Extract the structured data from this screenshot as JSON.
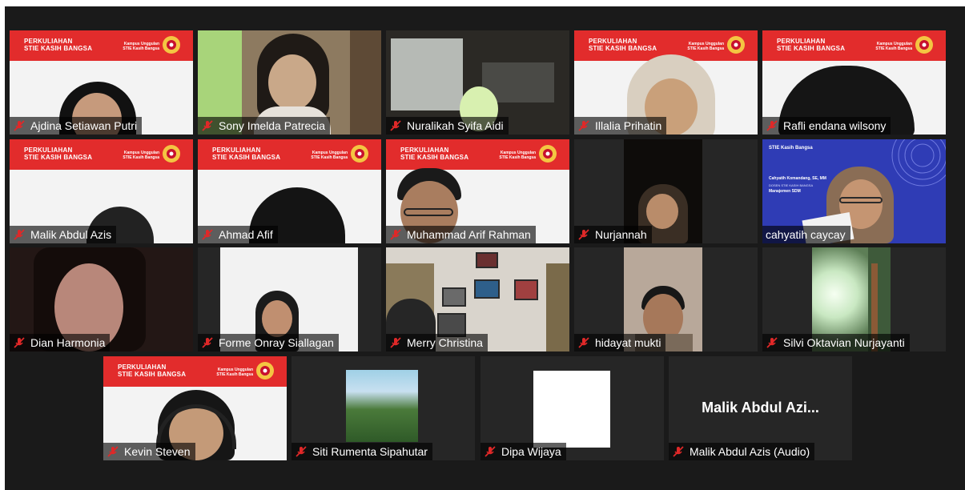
{
  "banner": {
    "line1": "PERKULIAHAN",
    "line2": "STIE KASIH BANGSA",
    "sub1": "Kampus Unggulan",
    "sub2": "STIE Kasih Bangsa"
  },
  "slide": {
    "header": "STIE Kasih Bangsa",
    "presenter": "Cahyatih Komandang, SE, MM",
    "role1": "DOSEN STIE KASIH BANGSA",
    "course": "Manajemen SDM"
  },
  "participants": [
    {
      "name": "Ajdina Setiawan Putri",
      "muted": true
    },
    {
      "name": "Sony Imelda Patrecia",
      "muted": true
    },
    {
      "name": "Nuralikah Syifa Aidi",
      "muted": true
    },
    {
      "name": "Illalia Prihatin",
      "muted": true
    },
    {
      "name": "Rafli endana wilsony",
      "muted": true
    },
    {
      "name": "Malik Abdul Azis",
      "muted": true
    },
    {
      "name": "Ahmad Afif",
      "muted": true
    },
    {
      "name": "Muhammad Arif Rahman",
      "muted": true
    },
    {
      "name": "Nurjannah",
      "muted": true
    },
    {
      "name": "cahyatih caycay",
      "muted": false,
      "active_speaker": true
    },
    {
      "name": "Dian Harmonia",
      "muted": true
    },
    {
      "name": "Forme Onray Siallagan",
      "muted": true
    },
    {
      "name": "Merry Christina",
      "muted": true
    },
    {
      "name": "hidayat mukti",
      "muted": true
    },
    {
      "name": "Silvi Oktavian Nurjayanti",
      "muted": true
    },
    {
      "name": "Kevin Steven",
      "muted": true
    },
    {
      "name": "Siti Rumenta Sipahutar",
      "muted": true
    },
    {
      "name": "Dipa Wijaya",
      "muted": true
    },
    {
      "name": "Malik Abdul Azis (Audio)",
      "muted": true,
      "placeholder": "Malik Abdul Azi..."
    }
  ],
  "colors": {
    "gallery_bg": "#1a1a1a",
    "tile_bg": "#262626",
    "banner_red": "#e22c2c",
    "active_speaker_border": "#d3e26a",
    "muted_mic": "#e02828"
  },
  "icons": {
    "muted": "muted-microphone-icon"
  }
}
